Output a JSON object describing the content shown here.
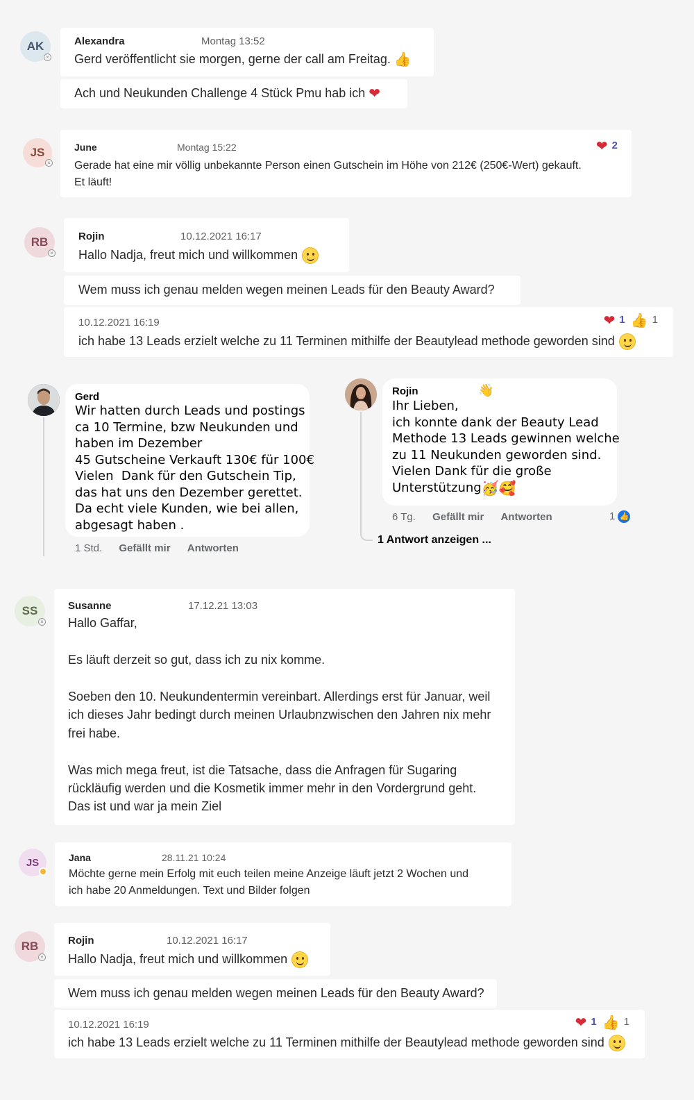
{
  "messages": {
    "alexandra": {
      "initials": "AK",
      "name": "Alexandra",
      "time": "Montag 13:52",
      "line1": "Gerd veröffentlicht sie morgen, gerne der call am Freitag.",
      "line2": "Ach und Neukunden Challenge 4 Stück Pmu hab ich"
    },
    "june": {
      "initials": "JS",
      "name": "June",
      "time": "Montag 15:22",
      "line1": "Gerade hat eine mir völlig unbekannte Person einen Gutschein im Höhe von 212€ (250€-Wert) gekauft.",
      "line2": "Et läuft!",
      "reaction_heart_count": "2"
    },
    "rojin1": {
      "initials": "RB",
      "name": "Rojin",
      "time": "10.12.2021 16:17",
      "line1": "Hallo Nadja, freut mich und willkommen",
      "line2": "Wem muss ich genau melden wegen meinen Leads für den Beauty Award?",
      "time2": "10.12.2021 16:19",
      "line3": "ich habe 13 Leads erzielt welche zu 11 Terminen mithilfe der Beautylead methode geworden sind",
      "reaction_heart_count": "1",
      "reaction_like_count": "1"
    },
    "susanne": {
      "initials": "SS",
      "name": "Susanne",
      "time": "17.12.21 13:03",
      "p1": "Hallo Gaffar,",
      "p2": "Es läuft derzeit so gut, dass ich zu nix komme.",
      "p3a": "Soeben den 10. Neukundentermin vereinbart. Allerdings erst für Januar, weil",
      "p3b": "ich dieses Jahr bedingt durch meinen Urlaubnzwischen den Jahren nix mehr",
      "p3c": "frei habe.",
      "p4a": "Was mich mega freut, ist die Tatsache, dass die Anfragen für Sugaring",
      "p4b": "rückläufig werden und die Kosmetik immer mehr in den Vordergrund geht.",
      "p4c": "Das ist und war ja mein Ziel"
    },
    "jana": {
      "initials": "JS",
      "name": "Jana",
      "time": "28.11.21 10:24",
      "line1": "Möchte gerne mein Erfolg mit euch teilen meine Anzeige läuft jetzt 2 Wochen und",
      "line2": "ich habe 20 Anmeldungen. Text und Bilder folgen"
    },
    "rojin2": {
      "initials": "RB",
      "name": "Rojin",
      "time": "10.12.2021 16:17",
      "line1": "Hallo Nadja, freut mich und willkommen",
      "line2": "Wem muss ich genau melden wegen meinen Leads für den Beauty Award?",
      "time2": "10.12.2021 16:19",
      "line3": "ich habe 13 Leads erzielt welche zu 11 Terminen mithilfe der Beautylead methode geworden sind",
      "reaction_heart_count": "1",
      "reaction_like_count": "1"
    }
  },
  "fb_comments": {
    "gerd": {
      "name": "Gerd",
      "text": "Wir hatten durch Leads und postings\nca 10 Termine, bzw Neukunden und\nhaben im Dezember\n45 Gutscheine Verkauft 130€ für 100€\nVielen  Dank für den Gutschein Tip,\ndas hat uns den Dezember gerettet.\nDa echt viele Kunden, wie bei allen,\nabgesagt haben .",
      "age": "1 Std.",
      "like_label": "Gefällt mir",
      "reply_label": "Antworten"
    },
    "rojin": {
      "name": "Rojin",
      "text": "Ihr Lieben,\nich konnte dank der Beauty Lead\nMethode 13 Leads gewinnen welche\nzu 11 Neukunden geworden sind.\nVielen Dank für die große\nUnterstützung",
      "age": "6 Tg.",
      "like_label": "Gefällt mir",
      "reply_label": "Antworten",
      "like_count": "1",
      "show_replies": "1 Antwort anzeigen ..."
    }
  },
  "colors": {
    "background": "#f5f5f5",
    "bubble": "#ffffff",
    "reaction_count": "#4f52b2",
    "heart": "#d52b36",
    "fb_like": "#1b74e4"
  }
}
